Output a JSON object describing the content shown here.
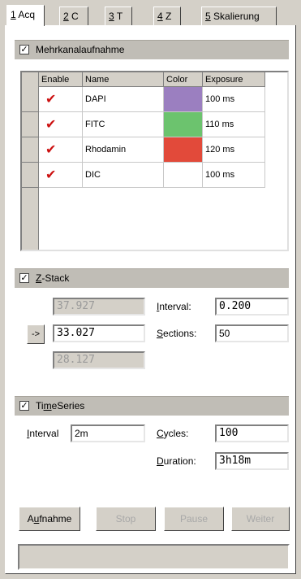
{
  "tabs": [
    {
      "key": "1",
      "label": "Acq"
    },
    {
      "key": "2",
      "label": "C"
    },
    {
      "key": "3",
      "label": "T"
    },
    {
      "key": "4",
      "label": "Z"
    },
    {
      "key": "5",
      "label": "Skalierung"
    }
  ],
  "multichannel": {
    "label": "Mehrkanalaufnahme",
    "checked": "✓",
    "columns": [
      "Enable",
      "Name",
      "Color",
      "Exposure"
    ],
    "rows": [
      {
        "enable": "✔",
        "name": "DAPI",
        "color": "#9b7fc0",
        "exposure": "100 ms"
      },
      {
        "enable": "✔",
        "name": "FITC",
        "color": "#6cc36e",
        "exposure": "110 ms"
      },
      {
        "enable": "✔",
        "name": "Rhodamin",
        "color": "#e24a3a",
        "exposure": "120 ms"
      },
      {
        "enable": "✔",
        "name": "DIC",
        "color": "#ffffff",
        "exposure": "100 ms"
      }
    ]
  },
  "zstack": {
    "label_hot": "Z",
    "label_rest": "-Stack",
    "checked": "✓",
    "top_value": "37.927",
    "go_button": "->",
    "center_value": "33.027",
    "bottom_value": "28.127",
    "interval_label_hot": "I",
    "interval_label_rest": "nterval:",
    "interval_value": "0.200",
    "sections_label_hot": "S",
    "sections_label_rest": "ections:",
    "sections_value": "50"
  },
  "timeseries": {
    "label_pre": "Ti",
    "label_hot": "m",
    "label_rest": "eSeries",
    "checked": "✓",
    "interval_label_hot": "I",
    "interval_label_rest": "nterval",
    "interval_value": "2m",
    "cycles_label_hot": "C",
    "cycles_label_rest": "ycles:",
    "cycles_value": "100",
    "duration_label_hot": "D",
    "duration_label_rest": "uration:",
    "duration_value": "3h18m"
  },
  "buttons": {
    "aufnahme_pre": "A",
    "aufnahme_hot": "u",
    "aufnahme_rest": "fnahme",
    "stop": "Stop",
    "pause": "Pause",
    "weiter": "Weiter"
  },
  "status_text": ""
}
